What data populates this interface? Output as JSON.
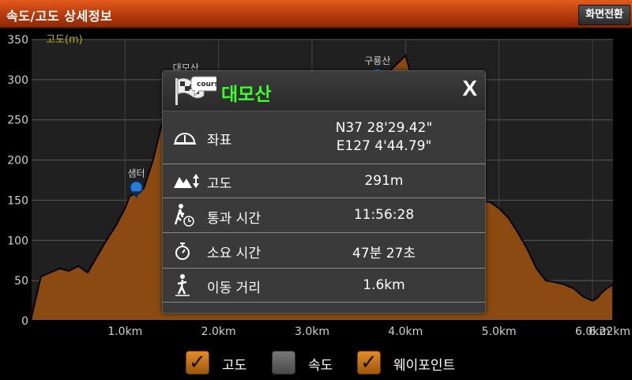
{
  "titlebar": {
    "title": "속도/고도 상세정보",
    "switch_label": "화면전환"
  },
  "chart_data": {
    "type": "area",
    "ylabel": "고도(m)",
    "ylim": [
      0,
      350
    ],
    "xlim": [
      0,
      6.22
    ],
    "y_ticks": [
      "350",
      "300",
      "250",
      "200",
      "150",
      "100",
      "50",
      "0"
    ],
    "x_ticks": [
      {
        "v": 1.0,
        "label": "1.0km"
      },
      {
        "v": 2.0,
        "label": "2.0km"
      },
      {
        "v": 3.0,
        "label": "3.0km"
      },
      {
        "v": 4.0,
        "label": "4.0km"
      },
      {
        "v": 5.0,
        "label": "5.0km"
      },
      {
        "v": 6.0,
        "label": "6.0km"
      },
      {
        "v": 6.22,
        "label": "6.22km"
      }
    ],
    "fill_color": "#8a4a12",
    "line_color": "#000000",
    "series": [
      {
        "x": [
          0,
          0.05,
          0.1,
          0.2,
          0.3,
          0.4,
          0.5,
          0.6,
          0.7,
          0.8,
          0.9,
          1.0,
          1.05,
          1.1,
          1.15,
          1.2,
          1.3,
          1.4,
          1.5,
          1.6,
          1.7,
          1.8,
          1.9,
          2.0,
          2.2,
          2.5,
          2.8,
          3.1,
          3.4,
          3.7,
          4.0,
          4.3,
          4.6,
          4.9,
          5.0,
          5.1,
          5.2,
          5.3,
          5.4,
          5.5,
          5.6,
          5.7,
          5.8,
          5.9,
          6.0,
          6.05,
          6.1,
          6.15,
          6.22
        ],
        "y": [
          5,
          30,
          55,
          60,
          65,
          62,
          68,
          60,
          80,
          100,
          118,
          140,
          155,
          158,
          160,
          165,
          200,
          248,
          262,
          274,
          278,
          285,
          291,
          286,
          280,
          270,
          275,
          283,
          290,
          296,
          330,
          210,
          150,
          148,
          140,
          128,
          110,
          90,
          65,
          50,
          48,
          45,
          40,
          30,
          25,
          28,
          35,
          40,
          45
        ]
      }
    ],
    "waypoints": [
      {
        "name": "샘터",
        "x": 1.12,
        "y": 160
      },
      {
        "name": "대모산",
        "x": 1.65,
        "y": 291
      },
      {
        "name": "구룡산",
        "x": 3.7,
        "y": 300
      }
    ]
  },
  "popup": {
    "title": "대모산",
    "close_label": "X",
    "icon_badge": "course",
    "rows": [
      {
        "label": "좌표",
        "value_line1": "N37 28'29.42\"",
        "value_line2": "E127 4'44.79\""
      },
      {
        "label": "고도",
        "value": "291m"
      },
      {
        "label": "통과 시간",
        "value": "11:56:28"
      },
      {
        "label": "소요 시간",
        "value": "47분 27초"
      },
      {
        "label": "이동 거리",
        "value": "1.6km"
      }
    ]
  },
  "legend": [
    {
      "label": "고도",
      "checked": true
    },
    {
      "label": "속도",
      "checked": false
    },
    {
      "label": "웨이포인트",
      "checked": true
    }
  ]
}
